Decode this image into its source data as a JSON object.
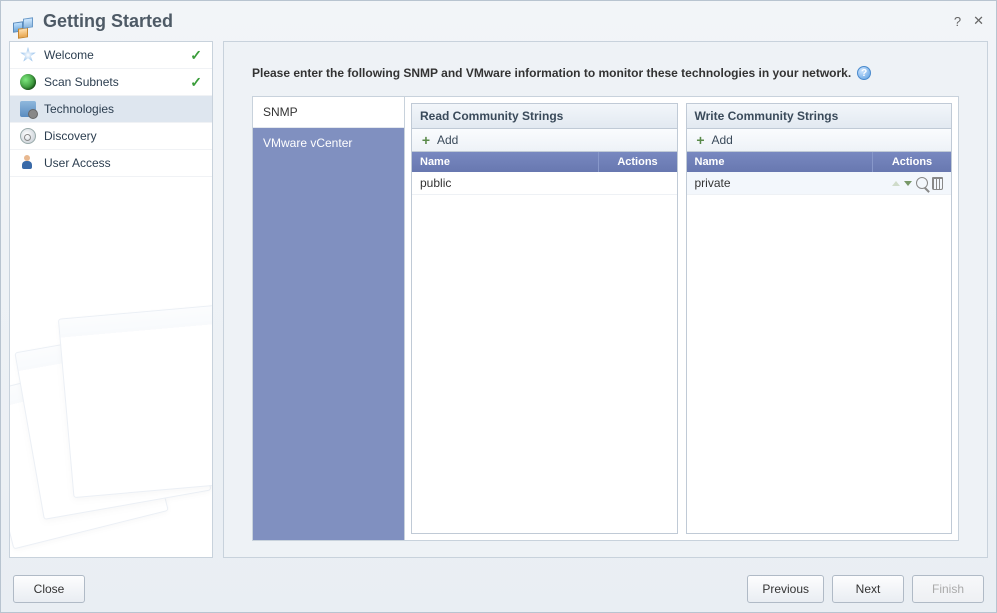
{
  "window": {
    "title": "Getting Started"
  },
  "sidebar": {
    "items": [
      {
        "label": "Welcome",
        "done": true
      },
      {
        "label": "Scan Subnets",
        "done": true
      },
      {
        "label": "Technologies"
      },
      {
        "label": "Discovery"
      },
      {
        "label": "User Access"
      }
    ]
  },
  "main": {
    "instruction": "Please enter the following SNMP and VMware information to monitor these technologies in your network.",
    "categories": [
      {
        "label": "SNMP"
      },
      {
        "label": "VMware vCenter"
      }
    ],
    "read_panel": {
      "title": "Read Community Strings",
      "add_label": "Add",
      "col_name": "Name",
      "col_actions": "Actions",
      "rows": [
        {
          "name": "public"
        }
      ]
    },
    "write_panel": {
      "title": "Write Community Strings",
      "add_label": "Add",
      "col_name": "Name",
      "col_actions": "Actions",
      "rows": [
        {
          "name": "private"
        }
      ]
    }
  },
  "footer": {
    "close": "Close",
    "previous": "Previous",
    "next": "Next",
    "finish": "Finish"
  }
}
